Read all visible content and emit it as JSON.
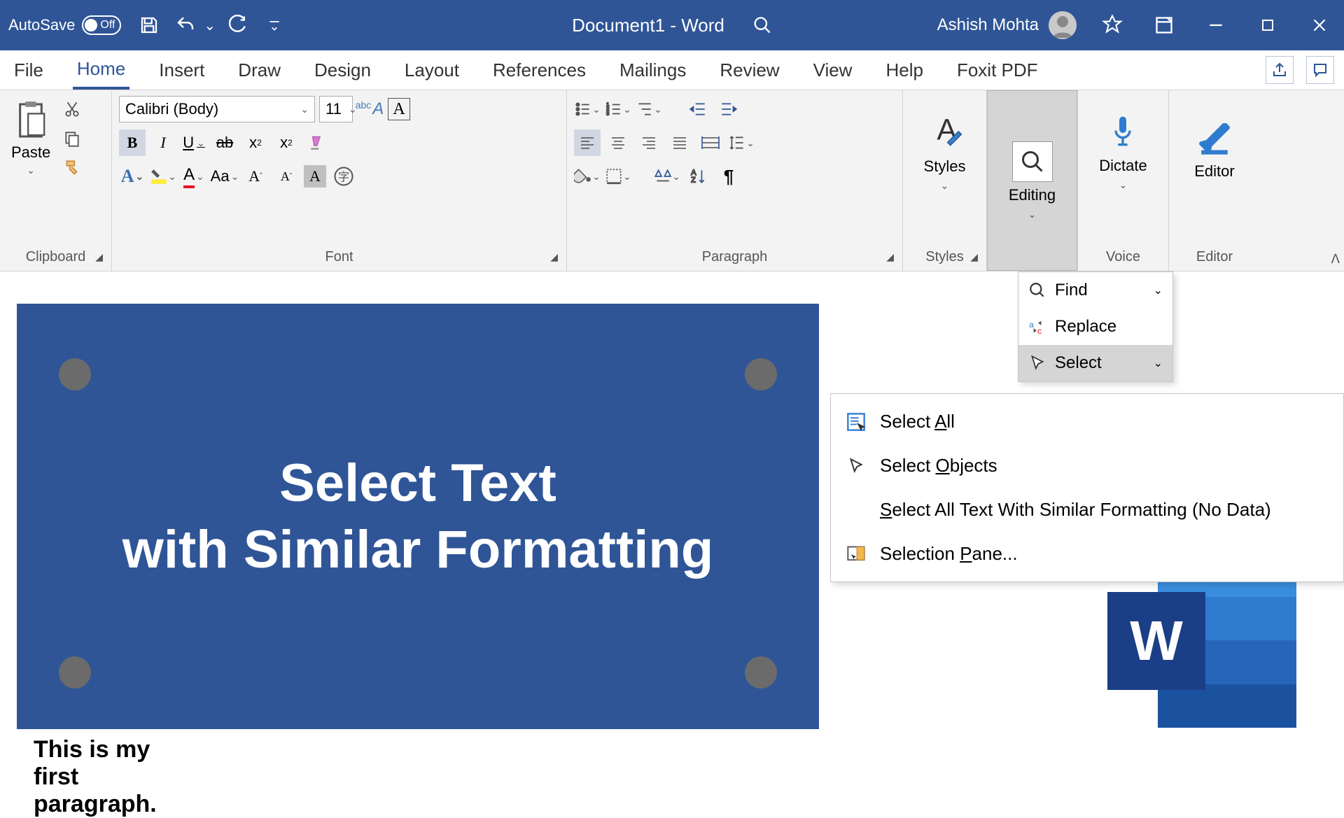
{
  "titlebar": {
    "autosave_label": "AutoSave",
    "autosave_state": "Off",
    "doc_title": "Document1  -  Word",
    "user_name": "Ashish Mohta"
  },
  "tabs": {
    "file": "File",
    "home": "Home",
    "insert": "Insert",
    "draw": "Draw",
    "design": "Design",
    "layout": "Layout",
    "references": "References",
    "mailings": "Mailings",
    "review": "Review",
    "view": "View",
    "help": "Help",
    "foxit": "Foxit PDF"
  },
  "ribbon": {
    "clipboard": {
      "paste": "Paste",
      "group": "Clipboard"
    },
    "font": {
      "name": "Calibri (Body)",
      "size": "11",
      "group": "Font",
      "bold": "B",
      "italic": "I",
      "underline": "U",
      "strike": "ab",
      "sub": "x",
      "sup": "x",
      "caseAa": "Aa"
    },
    "paragraph": {
      "group": "Paragraph"
    },
    "styles": {
      "label": "Styles",
      "group": "Styles"
    },
    "editing": {
      "label": "Editing"
    },
    "dictate": {
      "label": "Dictate",
      "group": "Voice"
    },
    "editor": {
      "label": "Editor",
      "group": "Editor"
    }
  },
  "editing_menu": {
    "find": "Find",
    "replace": "Replace",
    "select": "Select"
  },
  "select_menu": {
    "select_all_pre": "Select ",
    "select_all_u": "A",
    "select_all_post": "ll",
    "select_objects_pre": "Select ",
    "select_objects_u": "O",
    "select_objects_post": "bjects",
    "similar_u": "S",
    "similar_post": "elect All Text With Similar Formatting (No Data)",
    "pane_pre": "Selection ",
    "pane_u": "P",
    "pane_post": "ane..."
  },
  "document": {
    "banner_line1": "Select Text",
    "banner_line2": "with Similar Formatting",
    "paragraph": "This is my first paragraph."
  },
  "word_logo_letter": "W"
}
